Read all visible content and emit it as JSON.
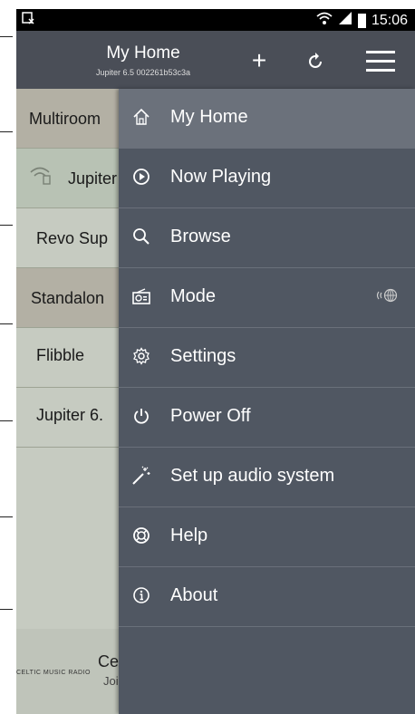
{
  "status_bar": {
    "time": "15:06"
  },
  "app_bar": {
    "title": "My Home",
    "subtitle": "Jupiter 6.5 002261b53c3a",
    "add_label": "+",
    "menu_icon": "hamburger-menu-icon",
    "refresh_icon": "refresh-icon"
  },
  "list": {
    "rows": [
      {
        "label": "Multiroom"
      },
      {
        "label": "Jupiter"
      },
      {
        "label": "Revo Sup"
      },
      {
        "label": "Standalon"
      },
      {
        "label": "Flibble"
      },
      {
        "label": "Jupiter 6."
      }
    ]
  },
  "player": {
    "logo_text": "CELTIC MUSIC RADIO",
    "line1": "Ce",
    "line2": "Joi"
  },
  "drawer": {
    "items": [
      {
        "label": "My Home",
        "icon": "home-icon"
      },
      {
        "label": "Now Playing",
        "icon": "play-circle-icon"
      },
      {
        "label": "Browse",
        "icon": "search-icon"
      },
      {
        "label": "Mode",
        "icon": "radio-icon"
      },
      {
        "label": "Settings",
        "icon": "gear-icon"
      },
      {
        "label": "Power Off",
        "icon": "power-icon"
      },
      {
        "label": "Set up audio system",
        "icon": "magic-wand-icon"
      },
      {
        "label": "Help",
        "icon": "lifebuoy-icon"
      },
      {
        "label": "About",
        "icon": "info-icon"
      }
    ]
  },
  "colors": {
    "appbar": "#4a4e57",
    "drawer": "#505762",
    "drawer_active": "#6b717b",
    "list_bg": "#c6cbc1"
  }
}
